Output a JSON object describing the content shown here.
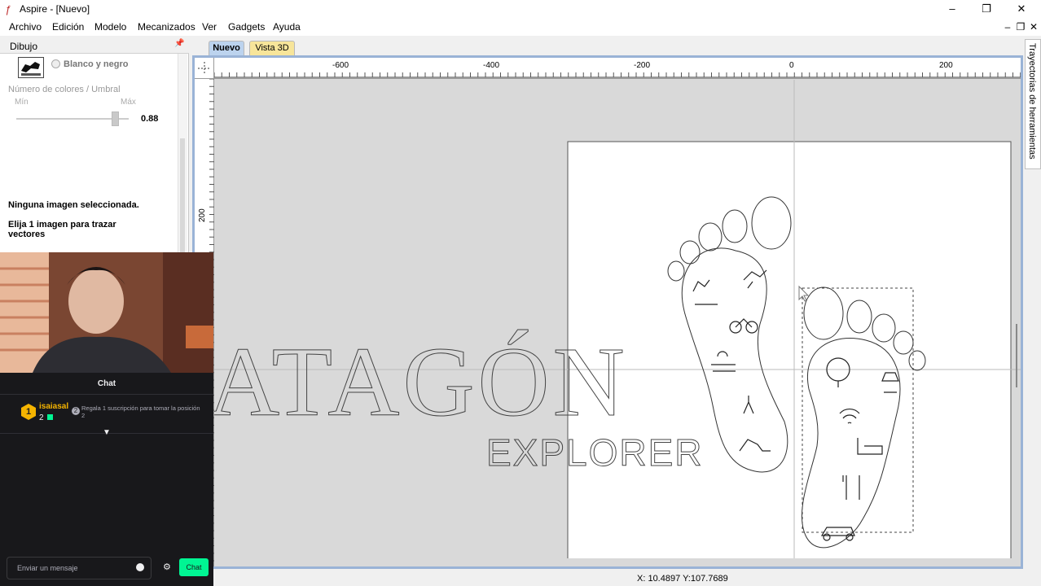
{
  "window": {
    "title": "Aspire - [Nuevo]",
    "app_icon": "aspire-app-icon",
    "controls": [
      "minimize",
      "maximize",
      "close"
    ]
  },
  "menu": [
    "Archivo",
    "Edición",
    "Modelo",
    "Mecanizados",
    "Ver",
    "Gadgets",
    "Ayuda"
  ],
  "left_panel": {
    "title": "Dibujo",
    "radio_label": "Blanco y negro",
    "colors_label": "Número de colores / Umbral",
    "slider_min_label": "Mín",
    "slider_max_label": "Máx",
    "slider_value_text": "0.88",
    "slider_fraction": 0.88,
    "message1": "Ninguna imagen seleccionada.",
    "message2": "Elija 1 imagen para trazar vectores"
  },
  "tabs": {
    "new": "Nuevo",
    "view3d": "Vista 3D"
  },
  "ruler": {
    "h_labels": [
      "-600",
      "-400",
      "-200",
      "0",
      "200"
    ],
    "v_label": "200"
  },
  "design": {
    "title_text": "ATAGÓN",
    "subtitle_text": "EXPLORER"
  },
  "right_tab": "Trayectorias de herramientas",
  "status": {
    "coords": "X: 10.4897 Y:107.7689"
  },
  "chat": {
    "header": "Chat",
    "rank": "1",
    "username": "isaiasal",
    "count": "2",
    "step": "2",
    "promo": "Regala 1 suscripción para tomar la posición 2",
    "input_placeholder": "Enviar un mensaje",
    "send_label": "Chat"
  },
  "colors": {
    "active_tab": "#bcd3ee",
    "inactive_tab": "#f7e59a",
    "view_border": "#9ab3d6",
    "chat_accent": "#00f593",
    "badge": "#f5b400"
  }
}
